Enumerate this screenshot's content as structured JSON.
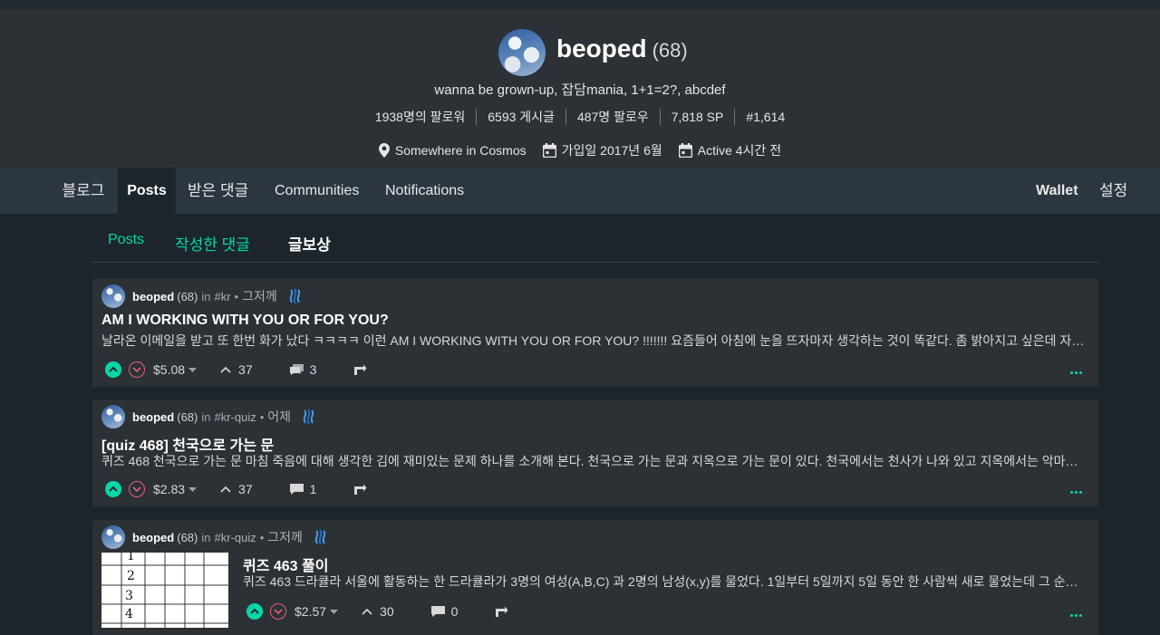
{
  "profile": {
    "name": "beoped",
    "reputation": "(68)",
    "about": "wanna be grown-up, 잡담mania, 1+1=2?, abcdef",
    "stats": {
      "followers": "1938명의 팔로워",
      "posts": "6593 게시글",
      "following": "487명 팔로우",
      "sp": "7,818 SP",
      "rank": "#1,614"
    },
    "location": "Somewhere in Cosmos",
    "joined": "가입일 2017년 6월",
    "active": "Active 4시간 전"
  },
  "nav": {
    "blog": "블로그",
    "posts": "Posts",
    "replies": "받은 댓글",
    "communities": "Communities",
    "notifications": "Notifications",
    "wallet": "Wallet",
    "settings": "설정"
  },
  "subtabs": {
    "posts": "Posts",
    "comments": "작성한 댓글",
    "payouts": "글보상"
  },
  "colors": {
    "accent": "#06d6a9",
    "downvote": "#e0607e",
    "background": "#1c252b",
    "card": "#2c3136"
  },
  "posts": [
    {
      "author": "beoped",
      "rep": "(68)",
      "in_label": "in",
      "tag": "#kr",
      "time": "그저께",
      "title": "AM I WORKING WITH YOU OR FOR YOU?",
      "excerpt": "날라온 이메일을 받고 또 한번 화가 났다 ㅋㅋㅋㅋ 이런 AM I WORKING WITH YOU OR FOR YOU? !!!!!!! 요즘들어 아침에 눈을 뜨자마자 생각하는 것이 똑같다. 좀 밝아지고 싶은데 자꾸 이메일이 나를 괴롭힌다",
      "payout": "$5.08",
      "votes": "37",
      "comments": "3"
    },
    {
      "author": "beoped",
      "rep": "(68)",
      "in_label": "in",
      "tag": "#kr-quiz",
      "time": "어제",
      "title": "[quiz 468] 천국으로 가는 문",
      "excerpt": "퀴즈 468 천국으로 가는 문 마침 죽음에 대해 생각한 김에 재미있는 문제 하나를 소개해 본다. 천국으로 가는 문과 지옥으로 가는 문이 있다. 천국에서는 천사가 나와 있고 지옥에서는 악마가 나와 있다",
      "payout": "$2.83",
      "votes": "37",
      "comments": "1"
    },
    {
      "author": "beoped",
      "rep": "(68)",
      "in_label": "in",
      "tag": "#kr-quiz",
      "time": "그저께",
      "title": "퀴즈 463 풀이",
      "excerpt": "퀴즈 463 드라큘라 서울에 활동하는 한 드라큘라가 3명의 여성(A,B,C) 과 2명의 남성(x,y)를 물었다. 1일부터 5일까지 5일 동안 한 사람씩 새로 물었는데 그 순서를 알아보자",
      "payout": "$2.57",
      "votes": "30",
      "comments": "0",
      "thumb_rows": [
        "1",
        "2",
        "3",
        "4"
      ]
    }
  ]
}
